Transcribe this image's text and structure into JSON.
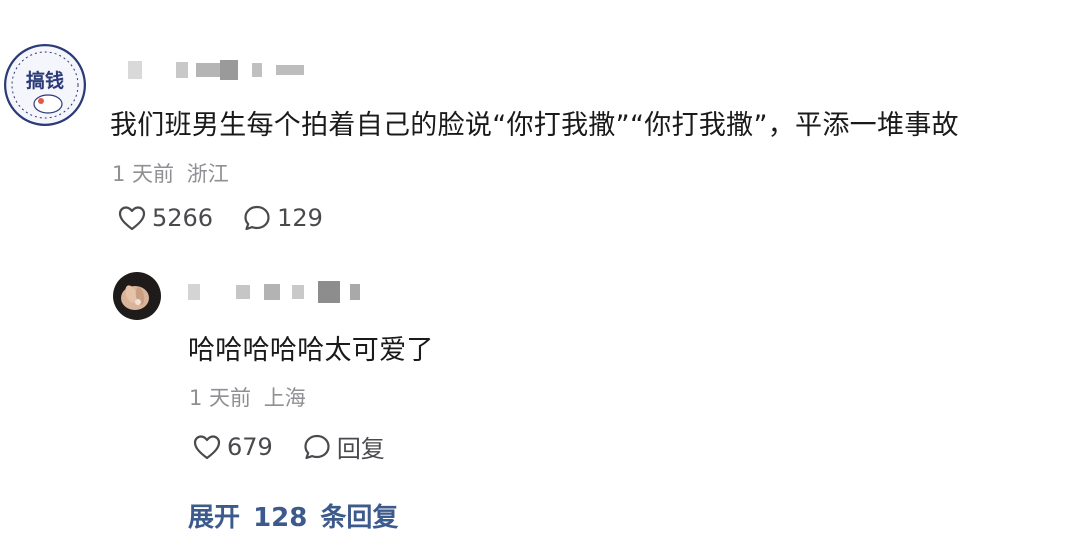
{
  "comment": {
    "text": "我们班男生每个拍着自己的脸说“你打我撒”“你打我撒”，平添一堆事故",
    "time": "1 天前",
    "location": "浙江",
    "likes": "5266",
    "replies": "129",
    "avatar_text": "搞钱"
  },
  "reply": {
    "text": "哈哈哈哈哈太可爱了",
    "time": "1 天前",
    "location": "上海",
    "likes": "679",
    "reply_label": "回复"
  },
  "expand": {
    "prefix": "展开",
    "count": "128",
    "suffix": "条回复"
  },
  "colors": {
    "text": "#1a1a1a",
    "meta": "#8f8f94",
    "icon": "#4a4a4e",
    "link": "#3d5a8c"
  },
  "icons": [
    "heart-icon",
    "comment-bubble-icon"
  ]
}
